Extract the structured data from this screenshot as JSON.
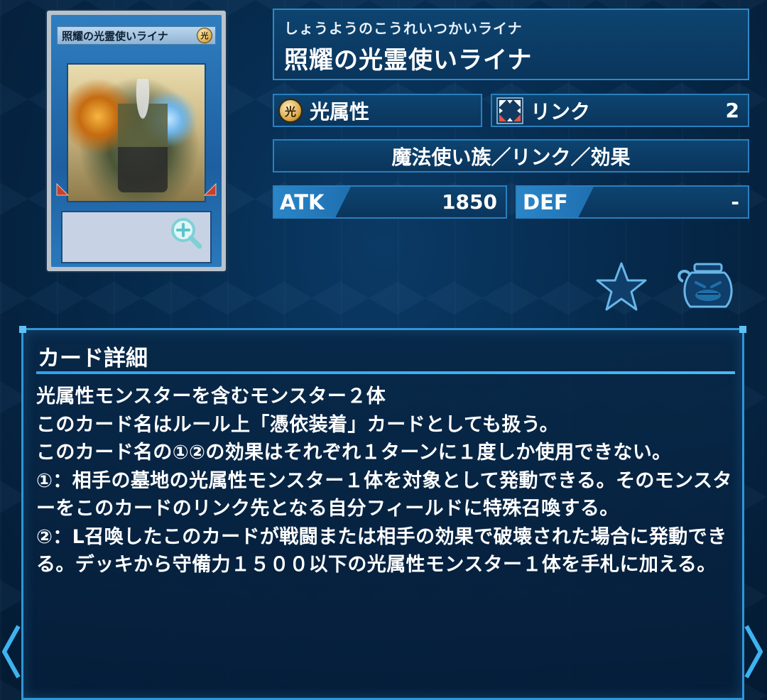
{
  "card": {
    "name_ruby": "しょうようのこうれいつかいライナ",
    "name": "照耀の光霊使いライナ",
    "mini_name": "照耀の光霊使いライナ",
    "attribute_glyph": "光",
    "attribute": "光属性",
    "card_type": "リンク",
    "link_rating": "2",
    "type_line": "魔法使い族／リンク／効果",
    "atk_label": "ATK",
    "atk": "1850",
    "def_label": "DEF",
    "def": "-"
  },
  "detail": {
    "title": "カード詳細",
    "text": "光属性モンスターを含むモンスター２体\nこのカード名はルール上「憑依装着」カードとしても扱う。\nこのカード名の①②の効果はそれぞれ１ターンに１度しか使用できない。\n①：相手の墓地の光属性モンスター１体を対象として発動できる。そのモンスターをこのカードのリンク先となる自分フィールドに特殊召喚する。\n②：L召喚したこのカードが戦闘または相手の効果で破壊された場合に発動できる。デッキから守備力１５００以下の光属性モンスター１体を手札に加える。"
  },
  "icons": {
    "star": "favorite-star-icon",
    "pot": "pot-of-greed-icon",
    "zoom": "zoom-in-icon",
    "link": "link-arrows-icon",
    "prev": "chevron-left-icon",
    "next": "chevron-right-icon"
  },
  "colors": {
    "accent": "#2f96d8",
    "panel": "#0a355c",
    "background": "#062646"
  }
}
